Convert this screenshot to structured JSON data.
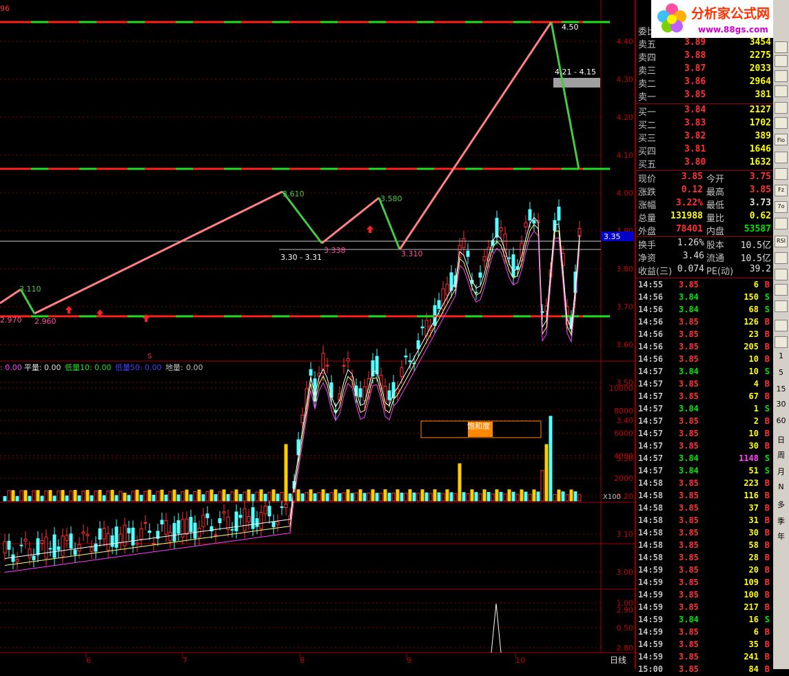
{
  "header": {
    "code_fragment": "96",
    "logo_title": "分析家公式网",
    "logo_url": "www.88gs.com"
  },
  "price_axis": [
    "4.40",
    "4.30",
    "4.20",
    "4.10",
    "4.00",
    "3.90",
    "3.80",
    "3.70",
    "3.60",
    "3.50",
    "3.40",
    "3.30",
    "3.20",
    "3.10",
    "3.00",
    "2.90",
    "2.80"
  ],
  "price_tag": "3.35",
  "annotations": {
    "peak": "4.50",
    "range_top": "4.21 - 4.15",
    "p1": "3.610",
    "p2": "3.580",
    "low1": "3.338",
    "low2": "3.310",
    "range_low": "3.30 - 3.31",
    "left_top": "3.110",
    "left_low1": "2.970",
    "left_low2": "2.960",
    "s_mark": "S"
  },
  "indicator_bar": {
    "item0": ": 0.00",
    "flat_label": "平量:",
    "flat_val": "0.00",
    "low10_label": "低量10:",
    "low10_val": "0.00",
    "low50_label": "低量50:",
    "low50_val": "0.00",
    "ground_label": "地量:",
    "ground_val": "0.00"
  },
  "volume_axis": [
    "10000",
    "8000",
    "6000",
    "4000",
    "2000"
  ],
  "volume_unit": "X100",
  "saturation_label": "饱和度",
  "bottom_axis": [
    "1.00",
    "0.50"
  ],
  "dates": [
    "6",
    "7",
    "8",
    "9",
    "10"
  ],
  "period_label": "日线",
  "order_book": {
    "title": "委比",
    "sell": [
      {
        "label": "卖五",
        "price": "3.89",
        "vol": "3454"
      },
      {
        "label": "卖四",
        "price": "3.88",
        "vol": "2275"
      },
      {
        "label": "卖三",
        "price": "3.87",
        "vol": "2033"
      },
      {
        "label": "卖二",
        "price": "3.86",
        "vol": "2964"
      },
      {
        "label": "卖一",
        "price": "3.85",
        "vol": "381"
      }
    ],
    "buy": [
      {
        "label": "买一",
        "price": "3.84",
        "vol": "2127"
      },
      {
        "label": "买二",
        "price": "3.83",
        "vol": "1702"
      },
      {
        "label": "买三",
        "price": "3.82",
        "vol": "389"
      },
      {
        "label": "买四",
        "price": "3.81",
        "vol": "1646"
      },
      {
        "label": "买五",
        "price": "3.80",
        "vol": "1632"
      }
    ]
  },
  "quote": [
    {
      "l1": "现价",
      "v1": "3.85",
      "c1": "red",
      "l2": "今开",
      "v2": "3.75",
      "c2": "red"
    },
    {
      "l1": "涨跌",
      "v1": "0.12",
      "c1": "red",
      "l2": "最高",
      "v2": "3.85",
      "c2": "red"
    },
    {
      "l1": "涨幅",
      "v1": "3.22%",
      "c1": "red",
      "l2": "最低",
      "v2": "3.73",
      "c2": "white"
    },
    {
      "l1": "总量",
      "v1": "131988",
      "c1": "yellow",
      "l2": "量比",
      "v2": "0.62",
      "c2": "yellow"
    },
    {
      "l1": "外盘",
      "v1": "78401",
      "c1": "red",
      "l2": "内盘",
      "v2": "53587",
      "c2": "green"
    }
  ],
  "finance": [
    {
      "l1": "换手",
      "v1": "1.26%",
      "l2": "股本",
      "v2": "10.5亿"
    },
    {
      "l1": "净资",
      "v1": "3.46",
      "l2": "流通",
      "v2": "10.5亿"
    },
    {
      "l1": "收益(三)",
      "v1": "0.074",
      "l2": "PE(动)",
      "v2": "39.2"
    }
  ],
  "ticks": [
    {
      "t": "14:55",
      "p": "3.85",
      "v": "6",
      "s": "B"
    },
    {
      "t": "14:56",
      "p": "3.84",
      "v": "150",
      "s": "S"
    },
    {
      "t": "14:56",
      "p": "3.84",
      "v": "68",
      "s": "S"
    },
    {
      "t": "14:56",
      "p": "3.85",
      "v": "126",
      "s": "B"
    },
    {
      "t": "14:56",
      "p": "3.85",
      "v": "23",
      "s": "B"
    },
    {
      "t": "14:56",
      "p": "3.85",
      "v": "205",
      "s": "B"
    },
    {
      "t": "14:56",
      "p": "3.85",
      "v": "10",
      "s": "B"
    },
    {
      "t": "14:57",
      "p": "3.84",
      "v": "10",
      "s": "S"
    },
    {
      "t": "14:57",
      "p": "3.85",
      "v": "4",
      "s": "B"
    },
    {
      "t": "14:57",
      "p": "3.85",
      "v": "67",
      "s": "B"
    },
    {
      "t": "14:57",
      "p": "3.84",
      "v": "1",
      "s": "S"
    },
    {
      "t": "14:57",
      "p": "3.85",
      "v": "2",
      "s": "B"
    },
    {
      "t": "14:57",
      "p": "3.85",
      "v": "10",
      "s": "B"
    },
    {
      "t": "14:57",
      "p": "3.85",
      "v": "30",
      "s": "B"
    },
    {
      "t": "14:57",
      "p": "3.84",
      "v": "1148",
      "s": "S"
    },
    {
      "t": "14:57",
      "p": "3.84",
      "v": "51",
      "s": "S"
    },
    {
      "t": "14:58",
      "p": "3.85",
      "v": "223",
      "s": "B"
    },
    {
      "t": "14:58",
      "p": "3.85",
      "v": "116",
      "s": "B"
    },
    {
      "t": "14:58",
      "p": "3.85",
      "v": "37",
      "s": "B"
    },
    {
      "t": "14:58",
      "p": "3.85",
      "v": "31",
      "s": "B"
    },
    {
      "t": "14:58",
      "p": "3.85",
      "v": "30",
      "s": "B"
    },
    {
      "t": "14:58",
      "p": "3.85",
      "v": "58",
      "s": "B"
    },
    {
      "t": "14:58",
      "p": "3.85",
      "v": "28",
      "s": "B"
    },
    {
      "t": "14:59",
      "p": "3.85",
      "v": "20",
      "s": "B"
    },
    {
      "t": "14:59",
      "p": "3.85",
      "v": "109",
      "s": "B"
    },
    {
      "t": "14:59",
      "p": "3.85",
      "v": "100",
      "s": "B"
    },
    {
      "t": "14:59",
      "p": "3.85",
      "v": "217",
      "s": "B"
    },
    {
      "t": "14:59",
      "p": "3.84",
      "v": "16",
      "s": "S"
    },
    {
      "t": "14:59",
      "p": "3.85",
      "v": "6",
      "s": "B"
    },
    {
      "t": "14:59",
      "p": "3.85",
      "v": "35",
      "s": "B"
    },
    {
      "t": "14:59",
      "p": "3.85",
      "v": "241",
      "s": "B"
    },
    {
      "t": "15:00",
      "p": "3.85",
      "v": "84",
      "s": "B"
    }
  ],
  "toolbar_text": [
    "1",
    "5",
    "15",
    "30",
    "60",
    "日",
    "周",
    "月",
    "N",
    "多",
    "季",
    "年"
  ],
  "toolbar_icons": [
    "RSI",
    "Fz",
    "Fio",
    "7o"
  ],
  "colors": {
    "up": "#ff3232",
    "down": "#54ffff",
    "green": "#00e600",
    "border": "#a00000",
    "zig_up": "#ff8080",
    "zig_down": "#44cc44"
  }
}
